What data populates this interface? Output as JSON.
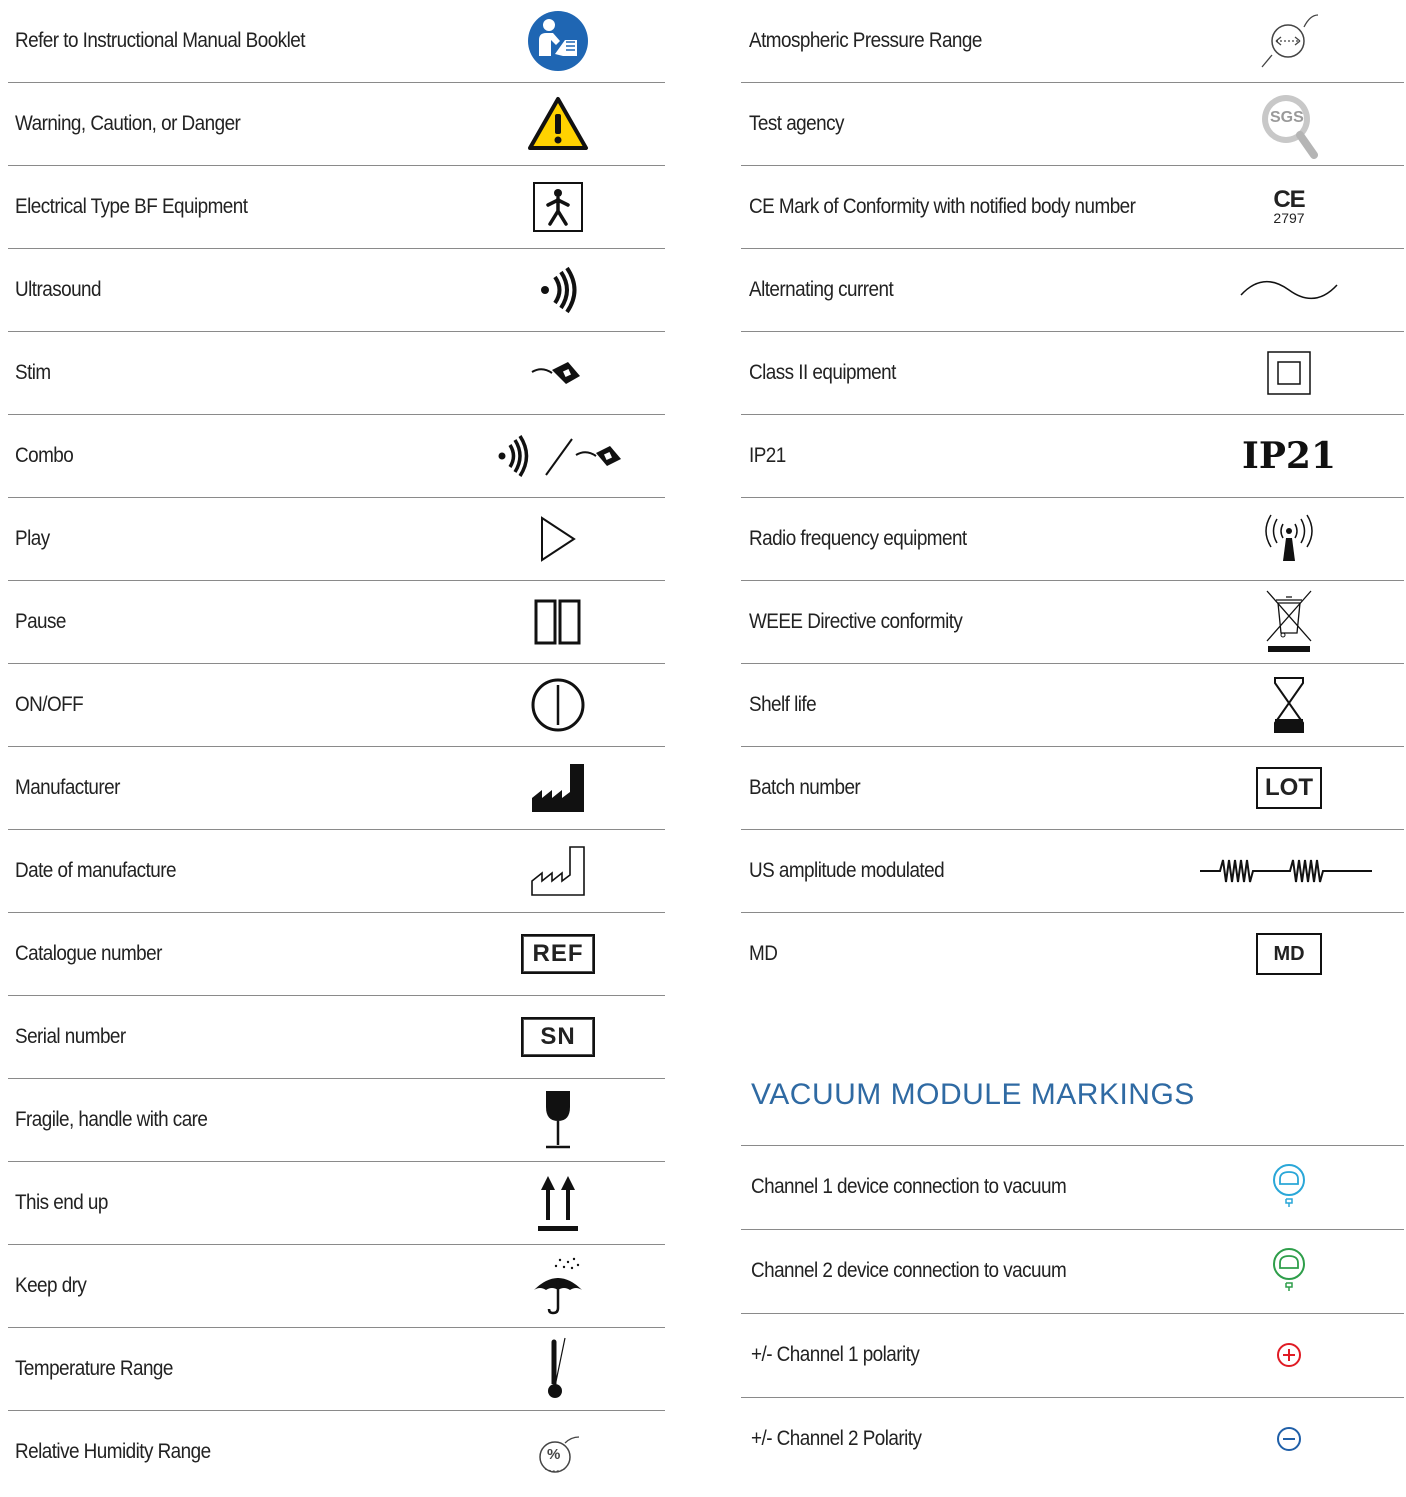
{
  "left_rows": [
    {
      "label": "Refer to Instructional Manual Booklet",
      "icon": "manual-booklet-icon"
    },
    {
      "label": "Warning, Caution, or Danger",
      "icon": "warning-triangle-icon"
    },
    {
      "label": "Electrical Type BF Equipment",
      "icon": "type-bf-icon"
    },
    {
      "label": "Ultrasound",
      "icon": "ultrasound-icon"
    },
    {
      "label": "Stim",
      "icon": "stim-icon"
    },
    {
      "label": "Combo",
      "icon": "combo-icon"
    },
    {
      "label": "Play",
      "icon": "play-icon"
    },
    {
      "label": "Pause",
      "icon": "pause-icon"
    },
    {
      "label": "ON/OFF",
      "icon": "power-icon"
    },
    {
      "label": "Manufacturer",
      "icon": "manufacturer-icon"
    },
    {
      "label": "Date of manufacture",
      "icon": "date-of-manufacture-icon"
    },
    {
      "label": "Catalogue number",
      "icon": "ref-icon",
      "icon_text": "REF"
    },
    {
      "label": "Serial number",
      "icon": "sn-icon",
      "icon_text": "SN"
    },
    {
      "label": "Fragile, handle with care",
      "icon": "fragile-icon"
    },
    {
      "label": "This end up",
      "icon": "this-end-up-icon"
    },
    {
      "label": "Keep dry",
      "icon": "keep-dry-icon"
    },
    {
      "label": "Temperature Range",
      "icon": "thermometer-icon"
    },
    {
      "label": "Relative Humidity Range",
      "icon": "humidity-icon",
      "icon_text": "%"
    }
  ],
  "right_rows": [
    {
      "label": "Atmospheric Pressure Range",
      "icon": "pressure-icon"
    },
    {
      "label": "Test agency",
      "icon": "sgs-icon",
      "icon_text": "SGS"
    },
    {
      "label": "CE Mark of Conformity with notified body number",
      "icon": "ce-mark-icon",
      "icon_text": "CE",
      "icon_subtext": "2797"
    },
    {
      "label": "Alternating current",
      "icon": "alternating-current-icon"
    },
    {
      "label": "Class II equipment",
      "icon": "class-ii-icon"
    },
    {
      "label": "IP21",
      "icon": "ip21-icon",
      "icon_text": "IP21"
    },
    {
      "label": "Radio frequency equipment",
      "icon": "radio-frequency-icon"
    },
    {
      "label": "WEEE Directive conformity",
      "icon": "weee-bin-icon"
    },
    {
      "label": "Shelf life",
      "icon": "hourglass-icon"
    },
    {
      "label": "Batch number",
      "icon": "lot-icon",
      "icon_text": "LOT"
    },
    {
      "label": "US amplitude modulated",
      "icon": "amplitude-modulated-icon"
    },
    {
      "label": "MD",
      "icon": "md-icon",
      "icon_text": "MD"
    }
  ],
  "vacuum": {
    "title": "VACUUM MODULE MARKINGS",
    "rows": [
      {
        "label": "Channel 1 device connection to vacuum",
        "icon": "channel-1-vacuum-icon",
        "color": "#2aa7d8"
      },
      {
        "label": "Channel 2 device connection to vacuum",
        "icon": "channel-2-vacuum-icon",
        "color": "#2e9e4a"
      },
      {
        "label": "+/- Channel 1 polarity",
        "icon": "plus-polarity-icon",
        "color": "#e01b24"
      },
      {
        "label": "+/- Channel 2 Polarity",
        "icon": "minus-polarity-icon",
        "color": "#1f5fa8"
      }
    ]
  },
  "colors": {
    "title": "#2f6aa3",
    "manual_blue": "#1f66b3",
    "warning_yellow": "#ffd200",
    "divider": "#8a8a8a"
  }
}
